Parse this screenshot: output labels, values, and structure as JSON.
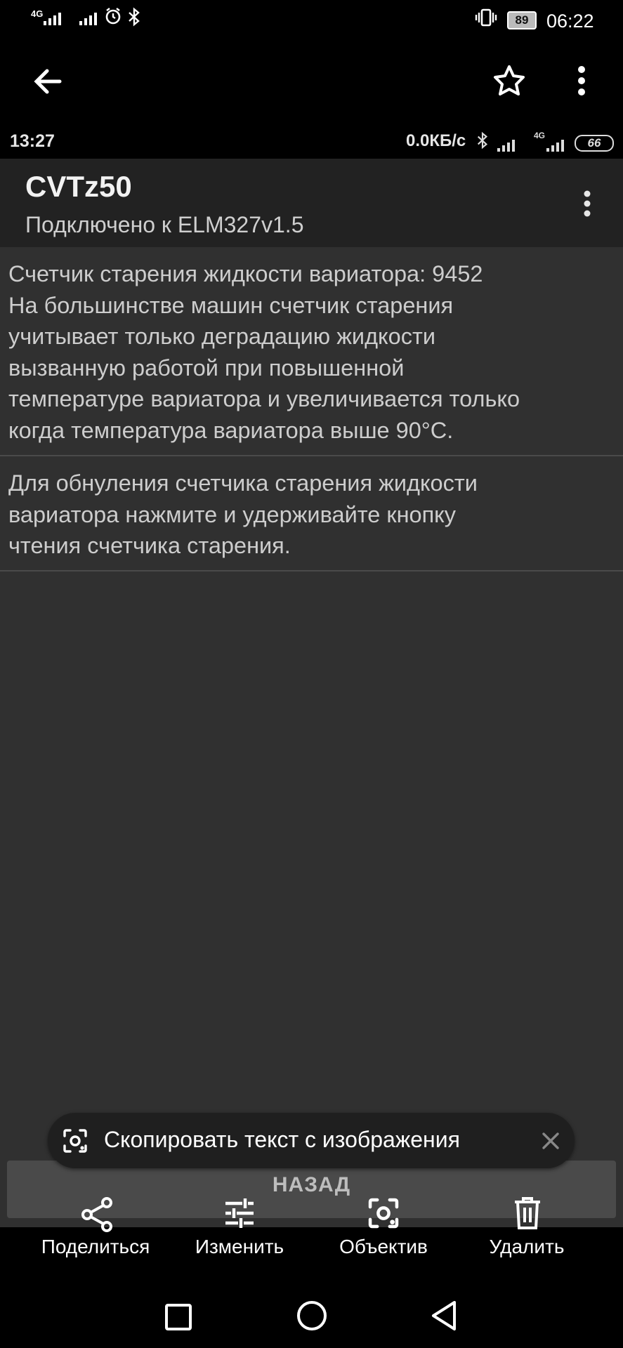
{
  "device_status": {
    "network_type": "4G",
    "battery_level": "89",
    "time": "06:22"
  },
  "inner_status": {
    "time": "13:27",
    "speed": "0.0КБ/с",
    "network_type": "4G",
    "battery_level": "66"
  },
  "app": {
    "title": "CVTz50",
    "subtitle": "Подключено к ELM327v1.5",
    "messages": [
      "Счетчик старения жидкости вариатора: 9452\nНа большинстве машин счетчик старения\nучитывает только деградацию жидкости\nвызванную работой при повышенной\nтемпературе вариатора и увеличивается только\nкогда температура вариатора выше 90°С.",
      "Для обнуления счетчика старения жидкости\nвариатора нажмите и удерживайте кнопку\nчтения счетчика старения."
    ],
    "back_button": "НАЗАД"
  },
  "copy_chip": {
    "label": "Скопировать текст с изображения"
  },
  "actions": {
    "share": "Поделиться",
    "edit": "Изменить",
    "lens": "Объектив",
    "delete": "Удалить"
  },
  "icons": {
    "back": "arrow-left-icon",
    "favorite": "star-outline-icon",
    "more": "more-vert-icon",
    "share": "share-icon",
    "edit": "tune-icon",
    "lens": "lens-icon",
    "delete": "trash-icon",
    "close": "close-icon"
  },
  "colors": {
    "content_bg": "#303030",
    "header_bg": "#222222",
    "button_bg": "#4a4a4a"
  }
}
